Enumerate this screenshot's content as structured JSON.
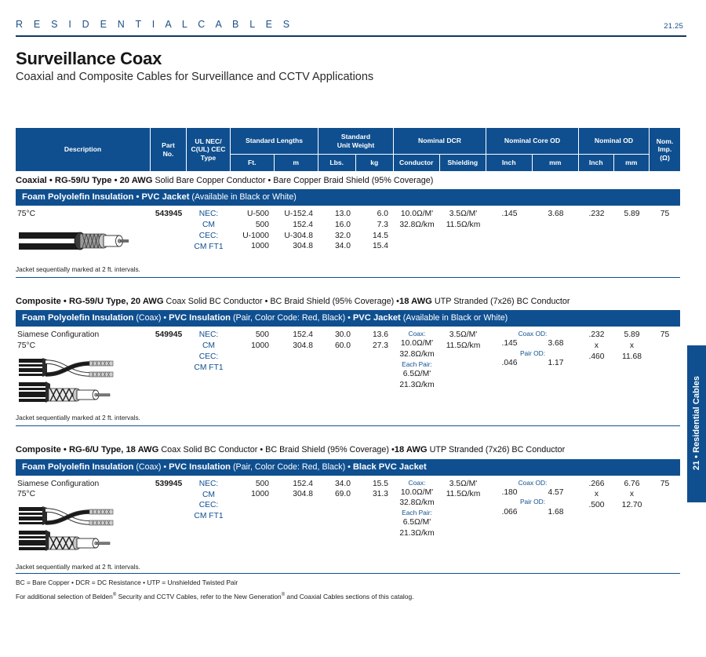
{
  "running_head": "R E S I D E N T I A L   C A B L E S",
  "folio": "21.25",
  "title": "Surveillance Coax",
  "subtitle": "Coaxial and Composite Cables for Surveillance and CCTV Applications",
  "side_tab": "21 • Residential Cables",
  "accent_color": "#0f4f8f",
  "table_header": {
    "description": "Description",
    "part_no_l1": "Part",
    "part_no_l2": "No.",
    "ul_l1": "UL NEC/",
    "ul_l2": "C(UL) CEC",
    "ul_l3": "Type",
    "std_lengths": "Standard Lengths",
    "std_lengths_ft": "Ft.",
    "std_lengths_m": "m",
    "unit_weight_l1": "Standard",
    "unit_weight_l2": "Unit Weight",
    "unit_weight_lbs": "Lbs.",
    "unit_weight_kg": "kg",
    "dcr": "Nominal DCR",
    "dcr_conductor": "Conductor",
    "dcr_shielding": "Shielding",
    "core_od": "Nominal Core OD",
    "core_od_inch": "Inch",
    "core_od_mm": "mm",
    "od": "Nominal OD",
    "od_inch": "Inch",
    "od_mm": "mm",
    "imp_l1": "Nom.",
    "imp_l2": "Imp.",
    "imp_l3": "(Ω)"
  },
  "sections": [
    {
      "heading_bold_1": "Coaxial • RG-59/U Type • 20 AWG",
      "heading_light_1": " Solid Bare Copper Conductor • Bare Copper Braid Shield (95% Coverage)",
      "band_bold_1": "Foam Polyolefin Insulation • PVC Jacket",
      "band_light_1": " (Available in Black or White)",
      "description": "75°C",
      "part_no": "543945",
      "ul_type": [
        "NEC:",
        "CM",
        "CEC:",
        "CM FT1"
      ],
      "lengths_ft": [
        "U-500",
        "500",
        "U-1000",
        "1000"
      ],
      "lengths_m": [
        "U-152.4",
        "152.4",
        "U-304.8",
        "304.8"
      ],
      "weight_lbs": [
        "13.0",
        "16.0",
        "32.0",
        "34.0"
      ],
      "weight_kg": [
        "6.0",
        "7.3",
        "14.5",
        "15.4"
      ],
      "dcr_conductor": [
        "10.0Ω/M'",
        "32.8Ω/km"
      ],
      "dcr_shielding": [
        "3.5Ω/M'",
        "11.5Ω/km"
      ],
      "core_inch": [
        ".145"
      ],
      "core_mm": [
        "3.68"
      ],
      "od_inch": [
        ".232"
      ],
      "od_mm": [
        "5.89"
      ],
      "impedance": "75",
      "note": "Jacket sequentially marked at 2 ft. intervals.",
      "art": "coax-single"
    },
    {
      "heading_bold_1": "Composite • RG-59/U Type, 20 AWG",
      "heading_light_1": " Coax Solid BC Conductor • BC Braid Shield (95% Coverage) •",
      "heading_bold_2": "18 AWG",
      "heading_light_2": " UTP Stranded (7x26) BC Conductor",
      "band_bold_1": "Foam Polyolefin Insulation",
      "band_light_1": " (Coax) • ",
      "band_bold_2": "PVC Insulation",
      "band_light_2": " (Pair, Color Code: Red, Black) • ",
      "band_bold_3": "PVC Jacket",
      "band_light_3": " (Available in Black or White)",
      "description_l1": "Siamese Configuration",
      "description_l2": "75°C",
      "part_no": "549945",
      "ul_type": [
        "NEC:",
        "CM",
        "CEC:",
        "CM FT1"
      ],
      "lengths_ft": [
        "500",
        "1000"
      ],
      "lengths_m": [
        "152.4",
        "304.8"
      ],
      "weight_lbs": [
        "30.0",
        "60.0"
      ],
      "weight_kg": [
        "13.6",
        "27.3"
      ],
      "dcr_conductor": [
        "Coax:",
        "10.0Ω/M'",
        "32.8Ω/km",
        "Each Pair:",
        "6.5Ω/M'",
        "21.3Ω/km"
      ],
      "dcr_shielding": [
        "3.5Ω/M'",
        "11.5Ω/km"
      ],
      "core_label_1": "Coax OD:",
      "core_inch_1": ".145",
      "core_mm_1": "3.68",
      "core_label_2": "Pair OD:",
      "core_inch_2": ".046",
      "core_mm_2": "1.17",
      "od_inch": [
        ".232",
        "x",
        ".460"
      ],
      "od_mm": [
        "5.89",
        "x",
        "11.68"
      ],
      "impedance": "75",
      "note": "Jacket sequentially marked at 2 ft. intervals.",
      "art": "siamese"
    },
    {
      "heading_bold_1": "Composite • RG-6/U Type, 18 AWG",
      "heading_light_1": " Coax Solid BC Conductor • BC Braid Shield (95% Coverage) •",
      "heading_bold_2": "18 AWG",
      "heading_light_2": " UTP Stranded (7x26) BC Conductor",
      "band_bold_1": "Foam Polyolefin Insulation",
      "band_light_1": " (Coax) • ",
      "band_bold_2": "PVC Insulation",
      "band_light_2": " (Pair, Color Code: Red, Black) • ",
      "band_bold_3": "Black PVC Jacket",
      "band_light_3": "",
      "description_l1": "Siamese Configuration",
      "description_l2": "75°C",
      "part_no": "539945",
      "ul_type": [
        "NEC:",
        "CM",
        "CEC:",
        "CM FT1"
      ],
      "lengths_ft": [
        "500",
        "1000"
      ],
      "lengths_m": [
        "152.4",
        "304.8"
      ],
      "weight_lbs": [
        "34.0",
        "69.0"
      ],
      "weight_kg": [
        "15.5",
        "31.3"
      ],
      "dcr_conductor": [
        "Coax:",
        "10.0Ω/M'",
        "32.8Ω/km",
        "Each Pair:",
        "6.5Ω/M'",
        "21.3Ω/km"
      ],
      "dcr_shielding": [
        "3.5Ω/M'",
        "11.5Ω/km"
      ],
      "core_label_1": "Coax OD:",
      "core_inch_1": ".180",
      "core_mm_1": "4.57",
      "core_label_2": "Pair OD:",
      "core_inch_2": ".066",
      "core_mm_2": "1.68",
      "od_inch": [
        ".266",
        "x",
        ".500"
      ],
      "od_mm": [
        "6.76",
        "x",
        "12.70"
      ],
      "impedance": "75",
      "note": "Jacket sequentially marked at 2 ft. intervals.",
      "art": "siamese"
    }
  ],
  "footnotes": {
    "abbrev": "BC = Bare Copper  •  DCR = DC Resistance  •  UTP = Unshielded Twisted Pair",
    "cross_ref_pre": "For additional selection of Belden",
    "cross_ref_mid": " Security and CCTV Cables, refer to the New Generation",
    "cross_ref_post": " and Coaxial Cables sections of this catalog."
  }
}
